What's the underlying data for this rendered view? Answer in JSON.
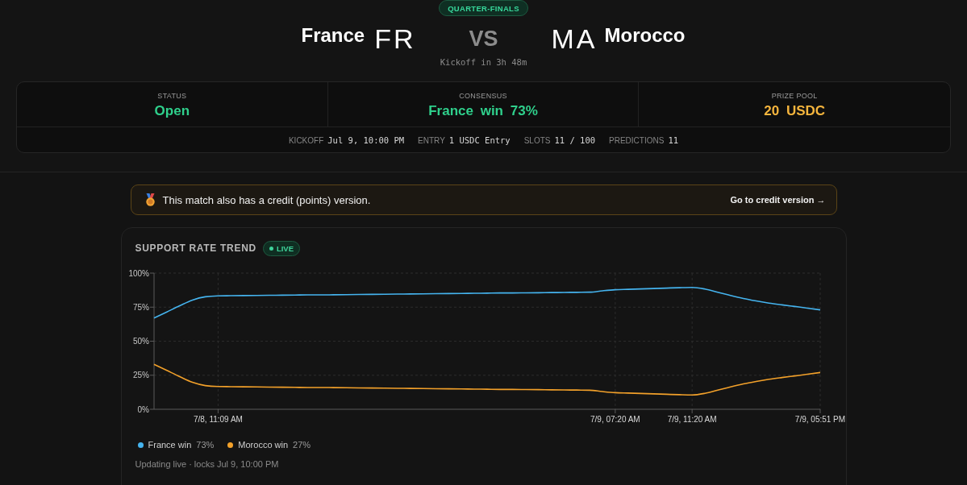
{
  "match": {
    "stage": "QUARTER-FINALS",
    "home": {
      "name": "France",
      "code": "FR"
    },
    "versus": "VS",
    "away": {
      "code": "MA",
      "name": "Morocco"
    },
    "countdown": "Kickoff in 3h 48m"
  },
  "stats": {
    "items": [
      {
        "label": "STATUS",
        "value": "Open",
        "color": "#2fd08c"
      },
      {
        "label": "CONSENSUS",
        "value": "France win 73%",
        "color": "#2fd08c"
      },
      {
        "label": "PRIZE POOL",
        "value": "20 USDC",
        "color": "#f5b53d"
      }
    ],
    "details": [
      {
        "label": "KICKOFF",
        "value": "Jul 9, 10:00 PM"
      },
      {
        "label": "ENTRY",
        "value": "1 USDC Entry"
      },
      {
        "label": "SLOTS",
        "value": "11 / 100"
      },
      {
        "label": "PREDICTIONS",
        "value": "11"
      }
    ]
  },
  "notice": {
    "text": "This match also has a credit (points) version.",
    "link": "Go to credit version →"
  },
  "trend": {
    "title": "SUPPORT RATE TREND",
    "badge": "LIVE",
    "chart_data": {
      "type": "line",
      "grid": true,
      "categories": [
        null,
        null,
        null,
        null,
        null,
        "7/8, 11:09 AM",
        null,
        null,
        null,
        null,
        null,
        null,
        null,
        null,
        null,
        null,
        null,
        null,
        null,
        null,
        null,
        null,
        null,
        null,
        null,
        null,
        null,
        null,
        null,
        null,
        null,
        null,
        null,
        null,
        null,
        null,
        "7/9, 07:20 AM",
        null,
        null,
        null,
        null,
        null,
        "7/9, 11:20 AM",
        null,
        null,
        null,
        null,
        null,
        null,
        null,
        null,
        null,
        "7/9, 05:51 PM"
      ],
      "series": [
        {
          "name": "France win",
          "color": "#45b4ef",
          "values": [
            67.0,
            71.5,
            76.0,
            80.2,
            82.6,
            83.3,
            83.4,
            83.5,
            83.6,
            83.7,
            83.8,
            83.9,
            84.0,
            84.0,
            84.1,
            84.2,
            84.3,
            84.4,
            84.5,
            84.6,
            84.7,
            84.8,
            84.9,
            85.0,
            85.1,
            85.2,
            85.3,
            85.4,
            85.4,
            85.5,
            85.6,
            85.7,
            85.8,
            85.9,
            86.0,
            87.0,
            87.8,
            88.1,
            88.4,
            88.7,
            89.0,
            89.3,
            89.5,
            88.3,
            86.0,
            83.6,
            81.4,
            79.6,
            78.0,
            76.7,
            75.5,
            74.3,
            73.0
          ]
        },
        {
          "name": "Morocco win",
          "color": "#f3a12a",
          "values": [
            33.0,
            28.5,
            24.0,
            19.8,
            17.4,
            16.7,
            16.6,
            16.5,
            16.4,
            16.3,
            16.2,
            16.1,
            16.0,
            16.0,
            15.9,
            15.8,
            15.7,
            15.6,
            15.5,
            15.4,
            15.3,
            15.2,
            15.1,
            15.0,
            14.9,
            14.8,
            14.7,
            14.6,
            14.6,
            14.5,
            14.4,
            14.3,
            14.2,
            14.1,
            14.0,
            13.0,
            12.2,
            11.9,
            11.6,
            11.3,
            11.0,
            10.7,
            10.5,
            11.7,
            14.0,
            16.4,
            18.6,
            20.4,
            22.0,
            23.3,
            24.5,
            25.7,
            27.0
          ]
        }
      ],
      "ylim": [
        0,
        100
      ],
      "yticks": [
        {
          "value": 0,
          "label": "0%"
        },
        {
          "value": 25,
          "label": "25%"
        },
        {
          "value": 50,
          "label": "50%"
        },
        {
          "value": 75,
          "label": "75%"
        },
        {
          "value": 100,
          "label": "100%"
        }
      ]
    },
    "legend_readings": [
      "73%",
      "27%"
    ],
    "note": "Updating live · locks Jul 9, 10:00 PM"
  }
}
